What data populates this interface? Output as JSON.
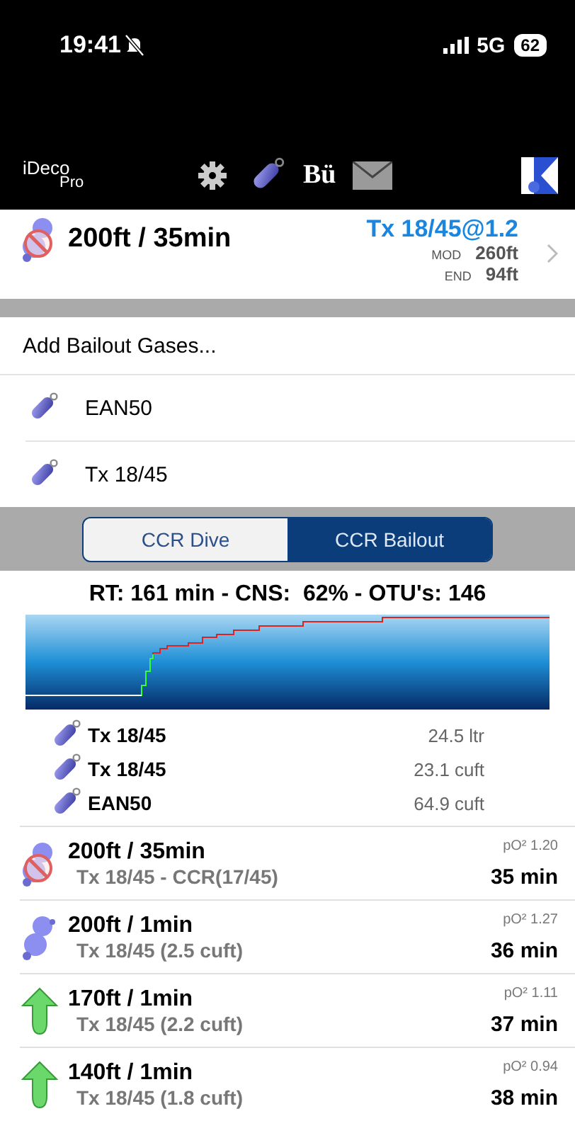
{
  "status_bar": {
    "time": "19:41",
    "silent": true,
    "network": "5G",
    "battery": "62"
  },
  "toolbar": {
    "app_name": "iDeco",
    "app_edition": "Pro",
    "bu_label": "Bü"
  },
  "dive": {
    "kind": "bottom-ccr",
    "title": "200ft / 35min",
    "gas": "Tx 18/45@1.2",
    "mod_label": "MOD",
    "mod": "260ft",
    "end_label": "END",
    "end": "94ft"
  },
  "bailout": {
    "header": "Add Bailout Gases...",
    "gases": [
      {
        "name": "EAN50"
      },
      {
        "name": "Tx 18/45"
      }
    ]
  },
  "tabs": [
    {
      "label": "CCR Dive",
      "selected": false
    },
    {
      "label": "CCR Bailout",
      "selected": true
    }
  ],
  "summary": "RT: 161 min - CNS:  62% - OTU's: 146",
  "gas_usage": [
    {
      "name": "Tx 18/45",
      "amount": "24.5 ltr"
    },
    {
      "name": "Tx 18/45",
      "amount": "23.1 cuft"
    },
    {
      "name": "EAN50",
      "amount": "64.9 cuft"
    }
  ],
  "segments": [
    {
      "kind": "bottom-ccr",
      "title": "200ft / 35min",
      "gas": "Tx 18/45 - CCR(17/45)",
      "po2": "pO² 1.20",
      "runtime": "35 min"
    },
    {
      "kind": "bottom",
      "title": "200ft / 1min",
      "gas": "Tx 18/45 (2.5 cuft)",
      "po2": "pO² 1.27",
      "runtime": "36 min"
    },
    {
      "kind": "ascent",
      "title": "170ft / 1min",
      "gas": "Tx 18/45 (2.2 cuft)",
      "po2": "pO² 1.11",
      "runtime": "37 min"
    },
    {
      "kind": "ascent",
      "title": "140ft / 1min",
      "gas": "Tx 18/45 (1.8 cuft)",
      "po2": "pO² 0.94",
      "runtime": "38 min"
    }
  ]
}
